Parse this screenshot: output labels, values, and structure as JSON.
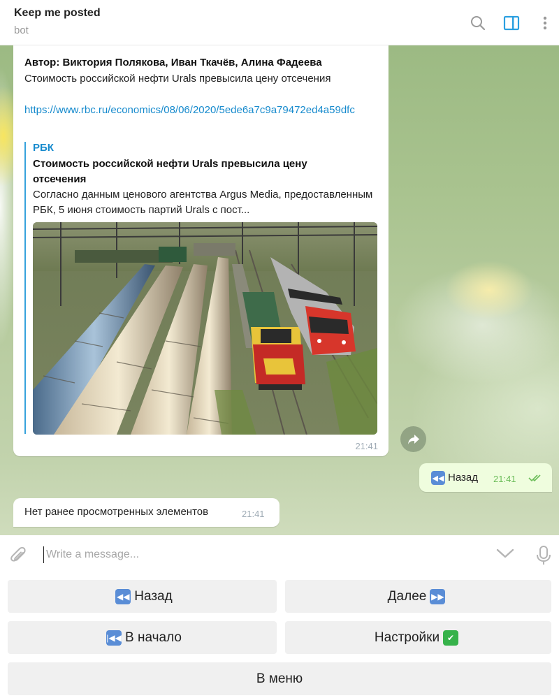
{
  "header": {
    "title": "Keep me posted",
    "subtitle": "bot"
  },
  "messages": {
    "m1": {
      "author_line": "Автор: Виктория Полякова, Иван Ткачёв, Алина Фадеева",
      "text": "Стоимость российской нефти Urals превысила цену отсечения",
      "link": "https://www.rbc.ru/economics/08/06/2020/5ede6a7c9a79472ed4a59dfc",
      "preview": {
        "site": "РБК",
        "title": "Стоимость российской нефти Urals превысила цену отсечения",
        "description": "Согласно данным ценового агентства Argus Media, предоставленным РБК, 5 июня стоимость партий Urals с пост..."
      },
      "time": "21:41"
    },
    "m2": {
      "text": "Назад",
      "time": "21:41",
      "status": "read"
    },
    "m3": {
      "text": "Нет ранее просмотренных элементов",
      "time": "21:41"
    }
  },
  "input": {
    "placeholder": "Write a message..."
  },
  "keyboard": {
    "back": "Назад",
    "next": "Далее",
    "to_start": "В начало",
    "settings": "Настройки",
    "menu": "В меню",
    "emoji": {
      "back": "⏪",
      "next": "⏩",
      "to_start": "⏮",
      "settings": "✅"
    }
  },
  "colors": {
    "accent": "#168acd",
    "link": "#168acd",
    "out_bubble": "#effdde",
    "read_check": "#6cbd5a"
  },
  "icons": [
    "search-icon",
    "sidebar-toggle-icon",
    "more-vertical-icon",
    "share-icon",
    "attach-icon",
    "chevron-down-icon",
    "microphone-icon",
    "double-check-icon"
  ]
}
